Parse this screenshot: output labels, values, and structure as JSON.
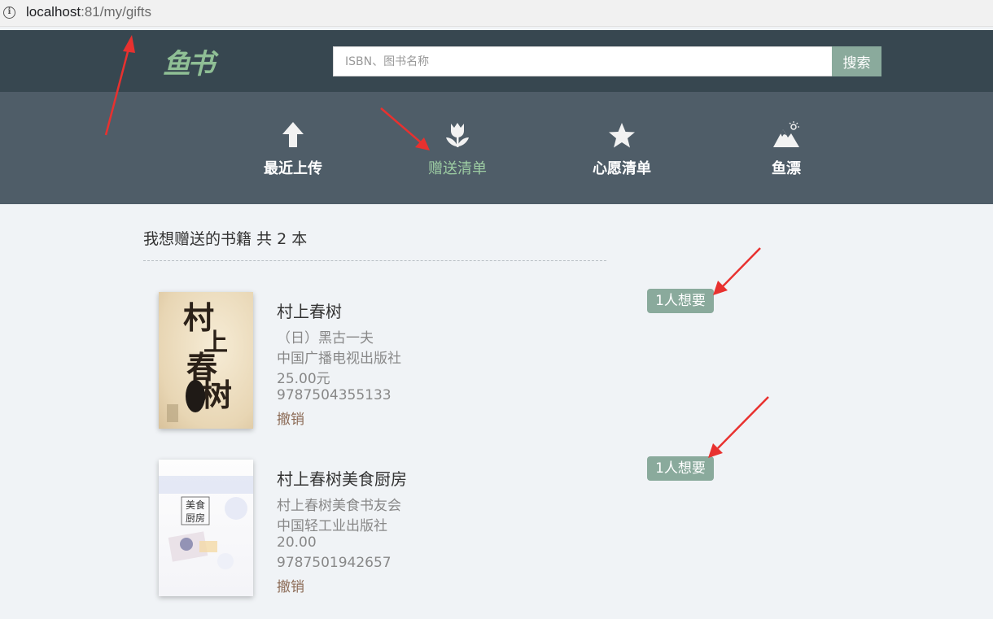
{
  "browser": {
    "url_host": "localhost",
    "url_rest": ":81/my/gifts"
  },
  "header": {
    "logo_text": "鱼书",
    "search_placeholder": "ISBN、图书名称",
    "search_button": "搜索"
  },
  "nav": {
    "items": [
      {
        "label": "最近上传",
        "icon": "arrow-up-icon"
      },
      {
        "label": "赠送清单",
        "icon": "tulip-icon",
        "active": true
      },
      {
        "label": "心愿清单",
        "icon": "star-icon"
      },
      {
        "label": "鱼漂",
        "icon": "mountain-icon"
      }
    ]
  },
  "main": {
    "heading": "我想赠送的书籍 共 2 本",
    "books": [
      {
        "title": "村上春树",
        "author": "（日）黑古一夫",
        "publisher": "中国广播电视出版社",
        "price": "25.00元",
        "isbn": "9787504355133",
        "action": "撤销",
        "wishes": "1人想要",
        "cover_text": "村上春树"
      },
      {
        "title": "村上春树美食厨房",
        "author": "村上春树美食书友会",
        "publisher": "中国轻工业出版社",
        "price": "20.00",
        "isbn": "9787501942657",
        "action": "撤销",
        "wishes": "1人想要",
        "cover_text": "美食厨房"
      }
    ]
  },
  "colors": {
    "topbar": "#374750",
    "navbar": "#4f5d68",
    "accent": "#8aaa9c",
    "active_nav": "#9dcda3",
    "annotation_arrow": "#e8312f"
  }
}
